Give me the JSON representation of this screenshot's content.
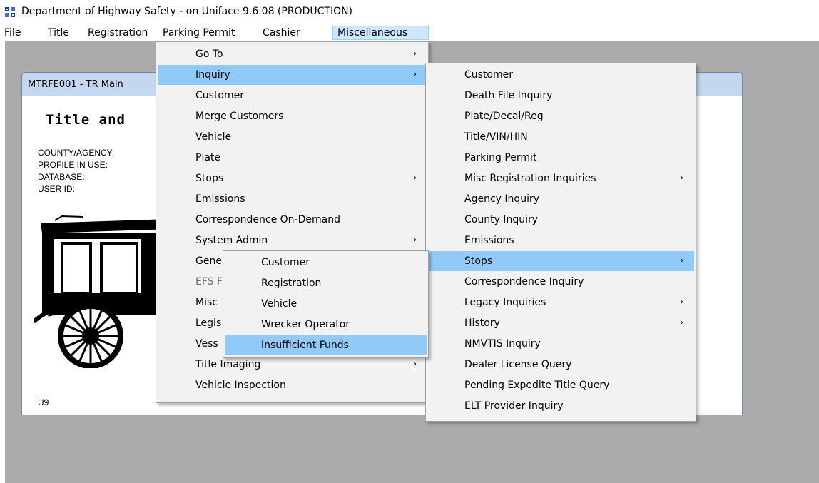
{
  "window": {
    "title": "Department of Highway Safety - on Uniface 9.6.08 (PRODUCTION)"
  },
  "menubar": {
    "items": [
      {
        "label": "File"
      },
      {
        "label": "Title"
      },
      {
        "label": "Registration"
      },
      {
        "label": "Parking Permit"
      },
      {
        "label": "Cashier"
      },
      {
        "label": "Miscellaneous",
        "active": true
      }
    ]
  },
  "child_window": {
    "title": "MTRFE001 - TR Main",
    "heading": "Title and",
    "fields": [
      {
        "label": "COUNTY/AGENCY:"
      },
      {
        "label": "PROFILE IN USE:"
      },
      {
        "label": "DATABASE:"
      },
      {
        "label": "USER ID:"
      }
    ],
    "footer": "U9"
  },
  "misc_menu": {
    "items": [
      {
        "label": "Go To",
        "submenu": true
      },
      {
        "label": "Inquiry",
        "submenu": true,
        "highlighted": true
      },
      {
        "label": "Customer"
      },
      {
        "label": "Merge Customers"
      },
      {
        "label": "Vehicle"
      },
      {
        "label": "Plate"
      },
      {
        "label": "Stops",
        "submenu": true
      },
      {
        "label": "Emissions"
      },
      {
        "label": "Correspondence On-Demand"
      },
      {
        "label": "System Admin",
        "submenu": true
      },
      {
        "label": "Gene"
      },
      {
        "label": "EFS F",
        "disabled": true
      },
      {
        "label": "Misc"
      },
      {
        "label": "Legis"
      },
      {
        "label": "Vess"
      },
      {
        "label": "Title Imaging",
        "submenu": true
      },
      {
        "label": "Vehicle Inspection"
      }
    ]
  },
  "inquiry_menu": {
    "items": [
      {
        "label": "Customer"
      },
      {
        "label": "Death File Inquiry"
      },
      {
        "label": "Plate/Decal/Reg"
      },
      {
        "label": "Title/VIN/HIN"
      },
      {
        "label": "Parking Permit"
      },
      {
        "label": "Misc Registration Inquiries",
        "submenu": true
      },
      {
        "label": "Agency Inquiry"
      },
      {
        "label": "County Inquiry"
      },
      {
        "label": "Emissions"
      },
      {
        "label": "Stops",
        "submenu": true,
        "highlighted": true
      },
      {
        "label": "Correspondence Inquiry"
      },
      {
        "label": "Legacy Inquiries",
        "submenu": true
      },
      {
        "label": "History",
        "submenu": true
      },
      {
        "label": "NMVTIS Inquiry"
      },
      {
        "label": "Dealer License Query"
      },
      {
        "label": "Pending Expedite Title Query"
      },
      {
        "label": "ELT Provider Inquiry"
      }
    ]
  },
  "stops_menu": {
    "items": [
      {
        "label": "Customer"
      },
      {
        "label": "Registration"
      },
      {
        "label": "Vehicle"
      },
      {
        "label": "Wrecker Operator"
      },
      {
        "label": "Insufficient Funds",
        "highlighted": true
      }
    ]
  },
  "icons": {
    "submenu_arrow": "chevron-right-icon",
    "app": "uniface-app-icon"
  },
  "colors": {
    "highlight": "#91c9f7",
    "menubar_active": "#cce8ff",
    "menu_bg": "#f2f2f2",
    "mdi_bg": "#ababab",
    "child_title_bg": "#c4d7ee",
    "disabled_text": "#6d6d6d"
  }
}
